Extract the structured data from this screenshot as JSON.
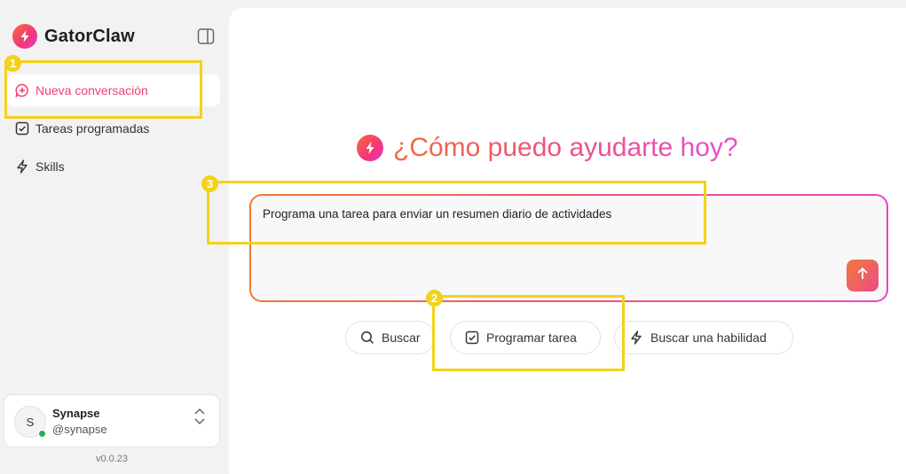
{
  "brand": {
    "name": "GatorClaw",
    "icon": "bolt-logo-icon"
  },
  "sidebar": {
    "items": [
      {
        "label": "Nueva conversación",
        "icon": "chat-plus-icon",
        "active": true
      },
      {
        "label": "Tareas programadas",
        "icon": "checkbox-icon",
        "active": false
      },
      {
        "label": "Skills",
        "icon": "bolt-icon",
        "active": false
      }
    ],
    "collapse_icon": "sidebar-toggle-icon"
  },
  "user": {
    "initial": "S",
    "name": "Synapse",
    "handle": "@synapse",
    "status": "online"
  },
  "version": "v0.0.23",
  "main": {
    "heading": "¿Cómo puedo ayudarte hoy?",
    "prompt_text": "Programa una tarea para enviar un resumen diario de actividades",
    "send_icon": "arrow-up-icon",
    "chips": [
      {
        "label": "Buscar",
        "icon": "search-icon"
      },
      {
        "label": "Programar tarea",
        "icon": "checkbox-icon"
      },
      {
        "label": "Buscar una habilidad",
        "icon": "bolt-icon"
      }
    ]
  },
  "annotations": [
    "1",
    "2",
    "3"
  ],
  "colors": {
    "accent": "#ef3e6e",
    "highlight": "#f2d21b",
    "online": "#22b35a"
  }
}
